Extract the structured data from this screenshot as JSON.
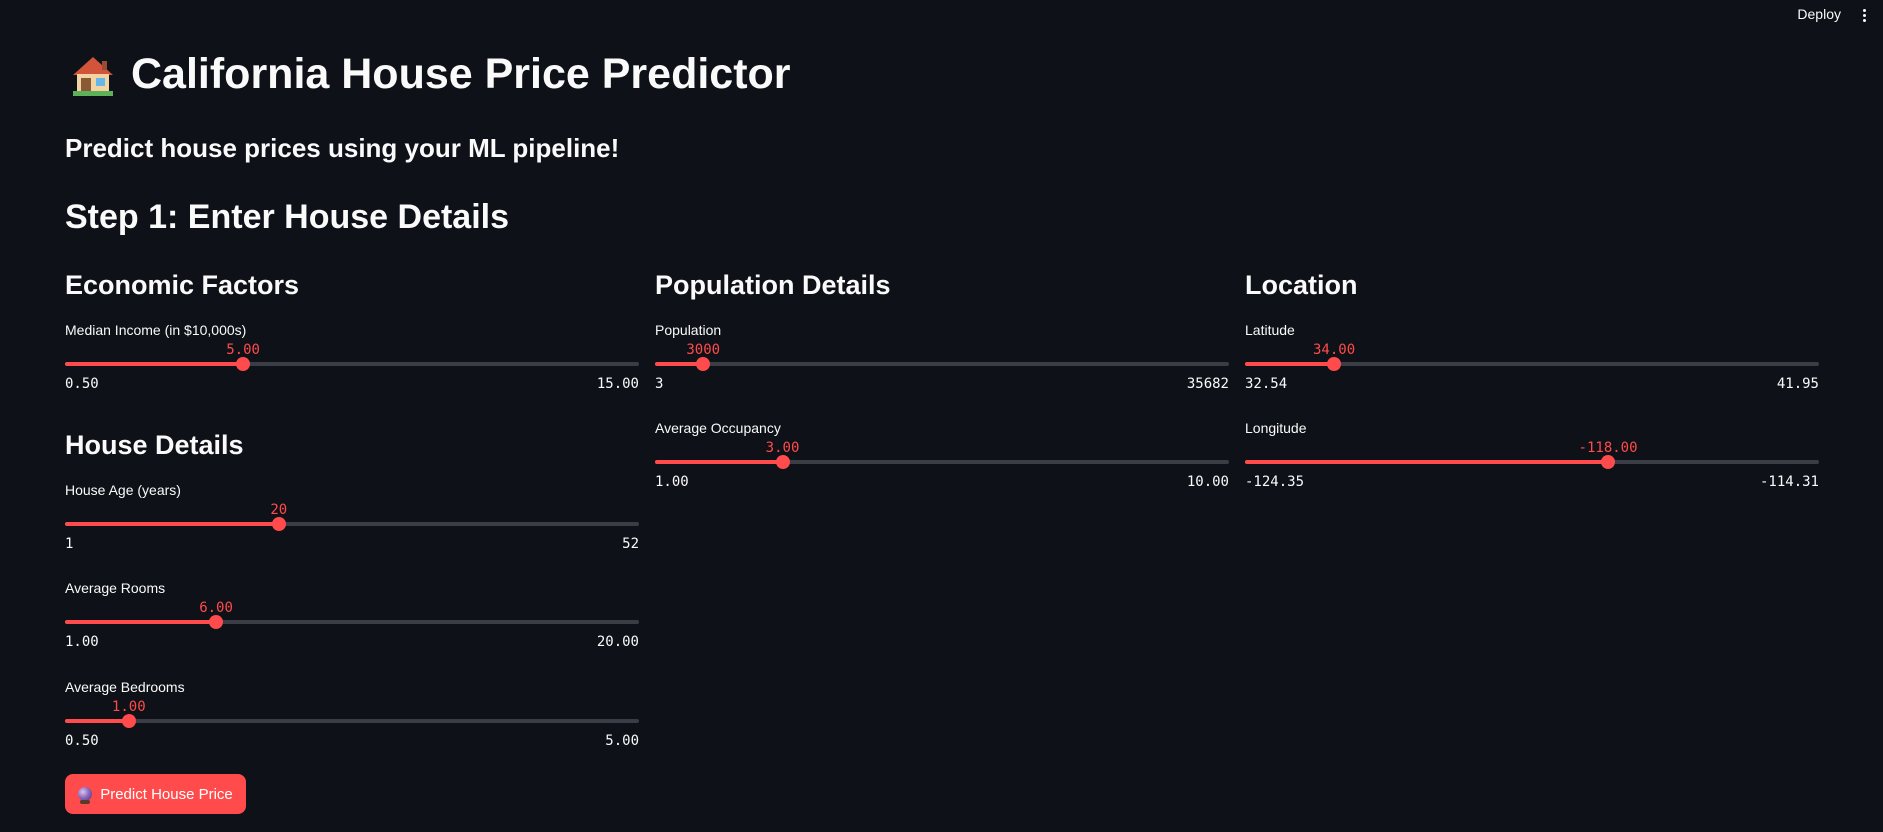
{
  "toolbar": {
    "deploy_label": "Deploy"
  },
  "header": {
    "title": "California House Price Predictor",
    "subtitle": "Predict house prices using your ML pipeline!",
    "step": "Step 1: Enter House Details"
  },
  "sections": {
    "economic": "Economic Factors",
    "house": "House Details",
    "population": "Population Details",
    "location": "Location"
  },
  "sliders": {
    "median_income": {
      "label": "Median Income (in $10,000s)",
      "value": "5.00",
      "min": "0.50",
      "max": "15.00",
      "fraction": 0.3103
    },
    "house_age": {
      "label": "House Age (years)",
      "value": "20",
      "min": "1",
      "max": "52",
      "fraction": 0.3725
    },
    "avg_rooms": {
      "label": "Average Rooms",
      "value": "6.00",
      "min": "1.00",
      "max": "20.00",
      "fraction": 0.2632
    },
    "avg_bedrooms": {
      "label": "Average Bedrooms",
      "value": "1.00",
      "min": "0.50",
      "max": "5.00",
      "fraction": 0.1111
    },
    "population": {
      "label": "Population",
      "value": "3000",
      "min": "3",
      "max": "35682",
      "fraction": 0.084
    },
    "avg_occupancy": {
      "label": "Average Occupancy",
      "value": "3.00",
      "min": "1.00",
      "max": "10.00",
      "fraction": 0.2222
    },
    "latitude": {
      "label": "Latitude",
      "value": "34.00",
      "min": "32.54",
      "max": "41.95",
      "fraction": 0.1552
    },
    "longitude": {
      "label": "Longitude",
      "value": "-118.00",
      "min": "-124.35",
      "max": "-114.31",
      "fraction": 0.6325
    }
  },
  "predict": {
    "label": "Predict House Price"
  },
  "colors": {
    "accent": "#ff4b4b",
    "background": "#0e1117",
    "track": "#3a3d45"
  },
  "icons": {
    "title": "house-icon",
    "predict": "crystal-ball-icon",
    "menu": "kebab-menu-icon"
  }
}
